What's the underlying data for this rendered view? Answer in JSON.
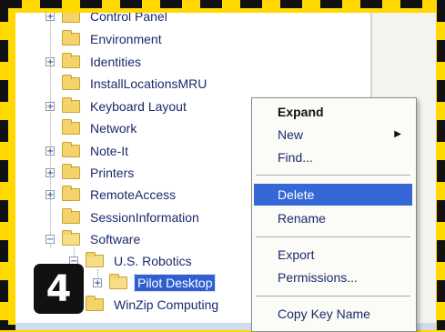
{
  "tree": {
    "items": [
      {
        "label": "Control Panel",
        "expander": "+",
        "indent": 0
      },
      {
        "label": "Environment",
        "expander": "",
        "indent": 0
      },
      {
        "label": "Identities",
        "expander": "+",
        "indent": 0
      },
      {
        "label": "InstallLocationsMRU",
        "expander": "",
        "indent": 0
      },
      {
        "label": "Keyboard Layout",
        "expander": "+",
        "indent": 0
      },
      {
        "label": "Network",
        "expander": "",
        "indent": 0
      },
      {
        "label": "Note-It",
        "expander": "+",
        "indent": 0
      },
      {
        "label": "Printers",
        "expander": "+",
        "indent": 0
      },
      {
        "label": "RemoteAccess",
        "expander": "+",
        "indent": 0
      },
      {
        "label": "SessionInformation",
        "expander": "",
        "indent": 0
      },
      {
        "label": "Software",
        "expander": "−",
        "indent": 0
      },
      {
        "label": "U.S. Robotics",
        "expander": "−",
        "indent": 1
      },
      {
        "label": "Pilot Desktop",
        "expander": "+",
        "indent": 2,
        "selected": true
      },
      {
        "label": "WinZip Computing",
        "expander": "+",
        "indent": 1
      }
    ]
  },
  "context_menu": {
    "expand": "Expand",
    "new": "New",
    "new_arrow": "▶",
    "find": "Find...",
    "delete": "Delete",
    "rename": "Rename",
    "export": "Export",
    "permissions": "Permissions...",
    "copy_key_name": "Copy Key Name"
  },
  "step_badge": "4",
  "colors": {
    "frame_yellow": "#ffd900",
    "selection_blue": "#2f5fd0",
    "menu_highlight": "#3567d6",
    "folder_yellow": "#f3d36a"
  }
}
